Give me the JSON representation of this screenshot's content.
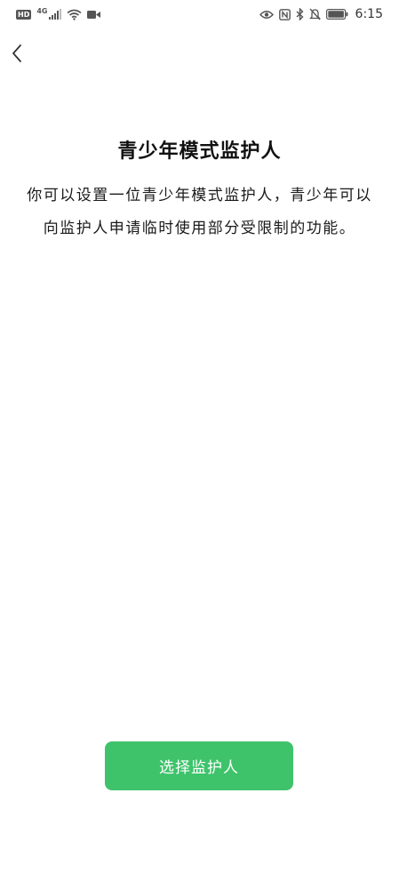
{
  "status_bar": {
    "hd_label": "HD",
    "network_label": "4G",
    "time": "6:15",
    "icons": [
      "hd-icon",
      "signal-icon",
      "wifi-icon",
      "video-icon",
      "eye-icon",
      "nfc-icon",
      "bluetooth-icon",
      "mute-icon",
      "battery-icon"
    ]
  },
  "header": {
    "back_icon": "chevron-left-icon"
  },
  "content": {
    "title": "青少年模式监护人",
    "description": "你可以设置一位青少年模式监护人，青少年可以向监护人申请临时使用部分受限制的功能。"
  },
  "actions": {
    "select_guardian_label": "选择监护人"
  },
  "colors": {
    "accent": "#3ec36b",
    "background": "#ffffff",
    "text": "#1a1a1a"
  }
}
